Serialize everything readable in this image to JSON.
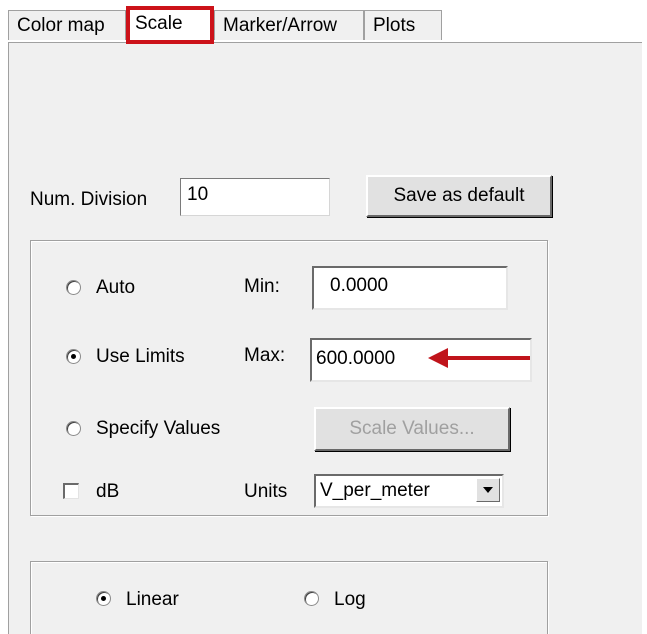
{
  "tabs": [
    {
      "label": "Color map",
      "active": false
    },
    {
      "label": "Scale",
      "active": true
    },
    {
      "label": "Marker/Arrow",
      "active": false
    },
    {
      "label": "Plots",
      "active": false
    }
  ],
  "num_division": {
    "label": "Num. Division",
    "value": "10"
  },
  "save_default_label": "Save as default",
  "scale_mode": {
    "options": [
      {
        "label": "Auto",
        "selected": false
      },
      {
        "label": "Use Limits",
        "selected": true
      },
      {
        "label": "Specify Values",
        "selected": false
      }
    ]
  },
  "min": {
    "label": "Min:",
    "value": "0.0000"
  },
  "max": {
    "label": "Max:",
    "value": "600.0000"
  },
  "scale_values_label": "Scale Values...",
  "db": {
    "label": "dB",
    "checked": false
  },
  "units": {
    "label": "Units",
    "value": "V_per_meter"
  },
  "scale_type": {
    "options": [
      {
        "label": "Linear",
        "selected": true
      },
      {
        "label": "Log",
        "selected": false
      }
    ]
  },
  "colors": {
    "highlight": "#cc1219",
    "annotation_arrow": "#c0141b",
    "panel": "#f0f0f0"
  },
  "icons": {
    "annotation": "arrow-left-icon",
    "dropdown": "chevron-down-icon"
  }
}
